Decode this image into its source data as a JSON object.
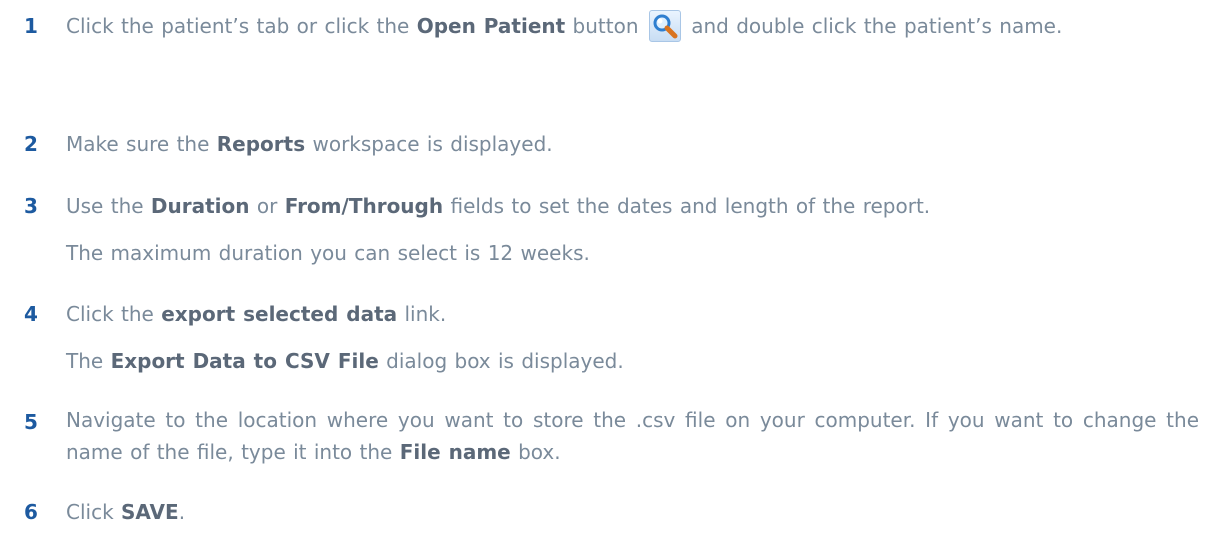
{
  "steps": [
    {
      "number": "1",
      "parts": [
        "Click the patient’s tab or click the ",
        "Open Patient",
        " button ",
        " and double click the patient’s name."
      ]
    },
    {
      "number": "2",
      "parts": [
        "Make sure the ",
        "Reports",
        " workspace is displayed."
      ]
    },
    {
      "number": "3",
      "parts": [
        "Use the ",
        "Duration",
        " or ",
        "From/Through",
        " fields to set the dates and length of the report."
      ],
      "note": "The maximum duration you can select is 12 weeks."
    },
    {
      "number": "4",
      "parts": [
        "Click the ",
        "export selected data",
        " link."
      ],
      "note_parts": [
        "The ",
        "Export Data to CSV File",
        " dialog box is displayed."
      ]
    },
    {
      "number": "5",
      "parts": [
        "Navigate to the location where you want to store the .csv file on your computer. If you want to change the name of the file, type it into the ",
        "File name",
        " box."
      ]
    },
    {
      "number": "6",
      "parts": [
        "Click ",
        "SAVE",
        "."
      ]
    }
  ],
  "icons": {
    "open_patient": "magnifier-icon"
  },
  "colors": {
    "text": "#7a8a9a",
    "number": "#1d5aa0",
    "bold": "#5b6878"
  }
}
